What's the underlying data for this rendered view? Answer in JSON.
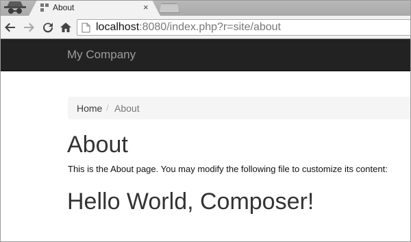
{
  "browser": {
    "tab": {
      "title": "About",
      "close_glyph": "×"
    },
    "toolbar": {
      "back_icon": "back-arrow-icon",
      "forward_icon": "forward-arrow-icon",
      "reload_icon": "reload-icon",
      "home_icon": "home-icon"
    },
    "address": {
      "host": "localhost",
      "rest": ":8080/index.php?r=site/about"
    }
  },
  "navbar": {
    "brand": "My Company"
  },
  "breadcrumb": {
    "home": "Home",
    "separator": "/",
    "active": "About"
  },
  "content": {
    "title": "About",
    "description": "This is the About page. You may modify the following file to customize its content:",
    "heading": "Hello World, Composer!"
  },
  "colors": {
    "navbar_bg": "#222222",
    "brand_text": "#9d9d9d",
    "breadcrumb_bg": "#f5f5f5"
  }
}
